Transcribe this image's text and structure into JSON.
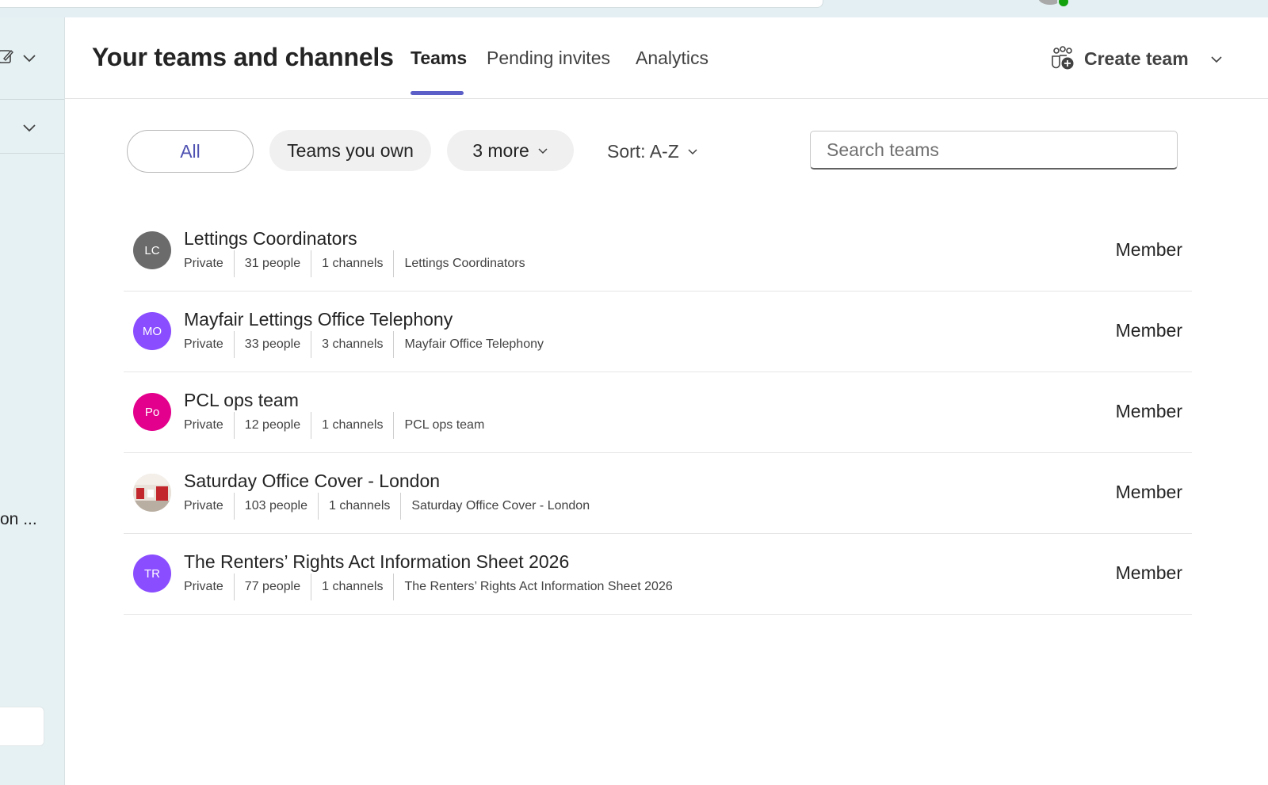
{
  "left_pane": {
    "truncated_text": "on ..."
  },
  "header": {
    "title": "Your teams and channels",
    "tabs": [
      {
        "label": "Teams",
        "active": true
      },
      {
        "label": "Pending invites",
        "active": false
      },
      {
        "label": "Analytics",
        "active": false
      }
    ],
    "create_team_label": "Create team",
    "accent_color": "#5b5fc7"
  },
  "filters": {
    "all_label": "All",
    "teams_you_own_label": "Teams you own",
    "more_label": "3 more",
    "sort_label": "Sort: A-Z",
    "search_placeholder": "Search teams"
  },
  "teams": [
    {
      "initials": "LC",
      "avatar_color": "#6b6b6b",
      "name": "Lettings Coordinators",
      "privacy": "Private",
      "people": "31 people",
      "channels": "1 channels",
      "description": "Lettings Coordinators",
      "role": "Member"
    },
    {
      "initials": "MO",
      "avatar_color": "#8a4dff",
      "name": "Mayfair Lettings Office Telephony",
      "privacy": "Private",
      "people": "33 people",
      "channels": "3 channels",
      "description": "Mayfair Office Telephony",
      "role": "Member"
    },
    {
      "initials": "Po",
      "avatar_color": "#e3008c",
      "name": "PCL ops team",
      "privacy": "Private",
      "people": "12 people",
      "channels": "1 channels",
      "description": "PCL ops team",
      "role": "Member"
    },
    {
      "initials": "",
      "avatar_color": "#d9d2c8",
      "name": "Saturday Office Cover - London",
      "privacy": "Private",
      "people": "103 people",
      "channels": "1 channels",
      "description": "Saturday Office Cover - London",
      "role": "Member"
    },
    {
      "initials": "TR",
      "avatar_color": "#8a4dff",
      "name": "The Renters’ Rights Act Information Sheet 2026",
      "privacy": "Private",
      "people": "77 people",
      "channels": "1 channels",
      "description": "The Renters’ Rights Act Information Sheet 2026",
      "role": "Member"
    }
  ]
}
